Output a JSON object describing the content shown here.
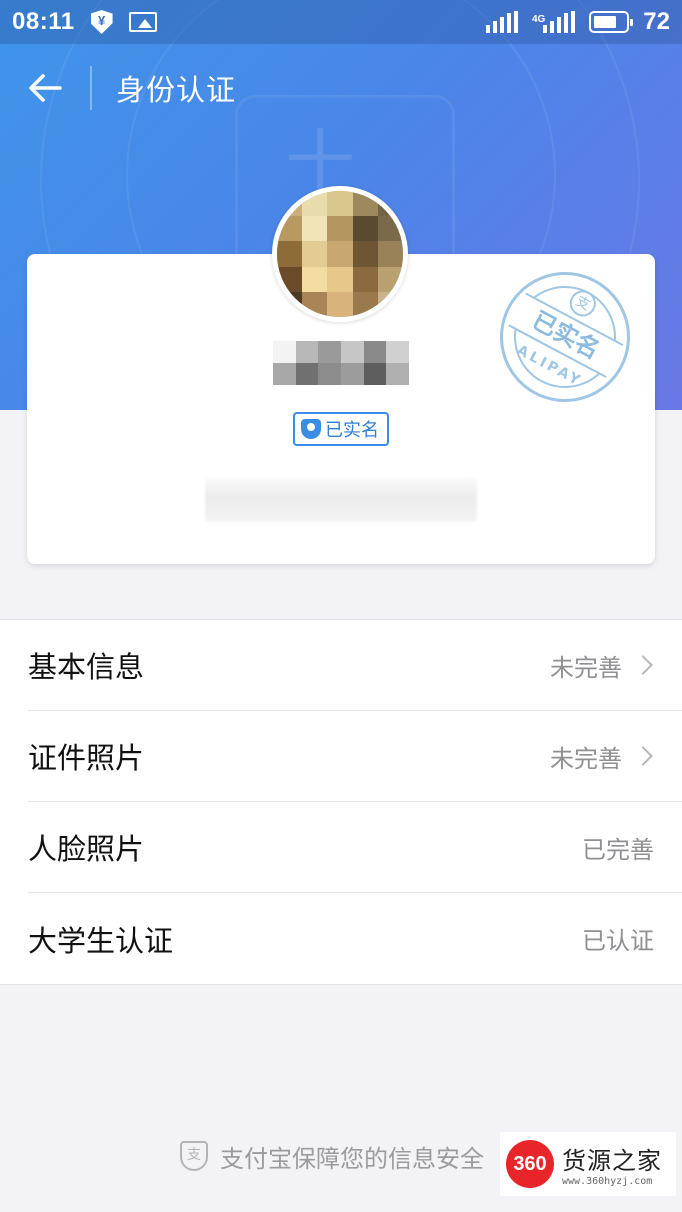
{
  "status_bar": {
    "time": "08:11",
    "network": "4G",
    "battery": "72",
    "battery_level": 0.72
  },
  "header": {
    "title": "身份认证",
    "back_icon": "arrow-left"
  },
  "profile": {
    "verified_badge": "已实名",
    "stamp_text": "已实名",
    "stamp_subtext": "ALIPAY"
  },
  "items": [
    {
      "label": "基本信息",
      "status": "未完善",
      "has_arrow": true
    },
    {
      "label": "证件照片",
      "status": "未完善",
      "has_arrow": true
    },
    {
      "label": "人脸照片",
      "status": "已完善",
      "has_arrow": false
    },
    {
      "label": "大学生认证",
      "status": "已认证",
      "has_arrow": false
    }
  ],
  "footer": {
    "note": "支付宝保障您的信息安全"
  },
  "watermark": {
    "logo": "360",
    "title": "货源之家",
    "url": "www.360hyzj.com"
  },
  "colors": {
    "header_gradient_start": "#3f95ea",
    "header_gradient_end": "#6a78e6",
    "accent": "#3a8de6",
    "page_bg": "#f3f3f7"
  }
}
